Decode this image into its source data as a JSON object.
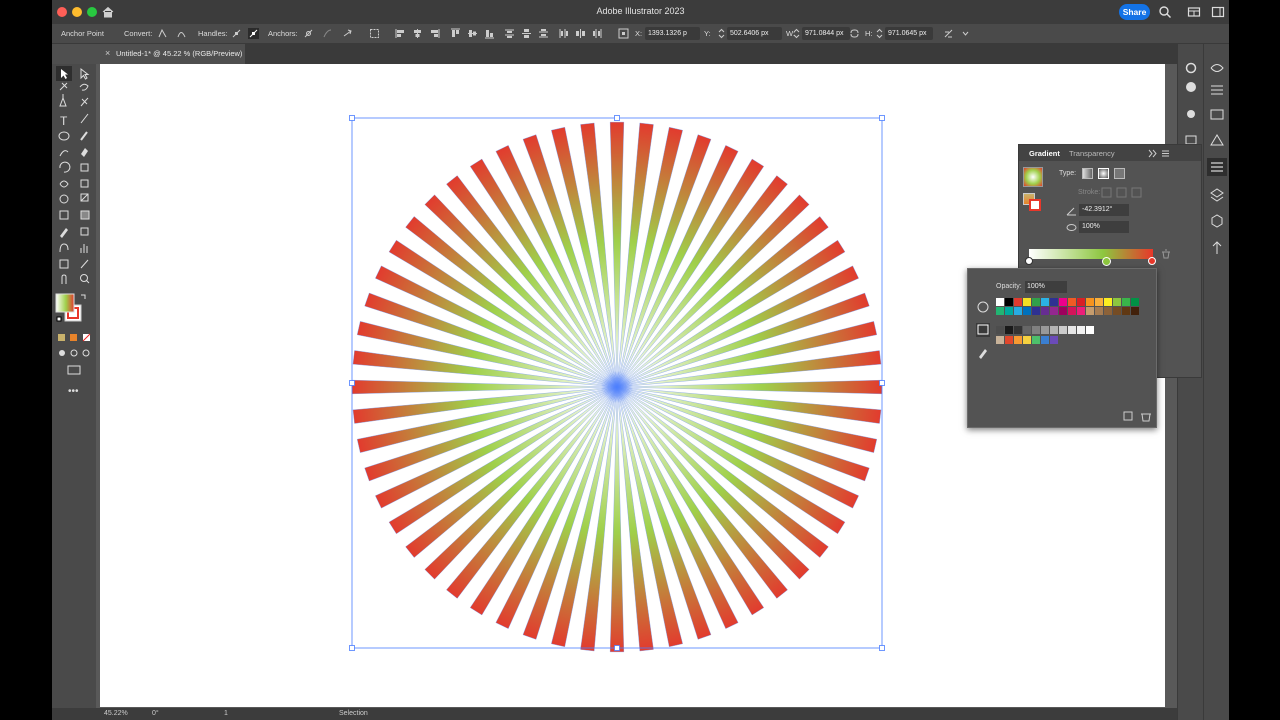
{
  "app": {
    "title": "Adobe Illustrator 2023",
    "share_label": "Share"
  },
  "control_bar": {
    "tool_name": "Anchor Point",
    "convert_label": "Convert:",
    "handles_label": "Handles:",
    "anchors_label": "Anchors:",
    "x_label": "X:",
    "x_value": "1393.1326 p",
    "y_label": "Y:",
    "y_value": "502.6406 px",
    "w_label": "W:",
    "w_value": "971.0844 px",
    "h_label": "H:",
    "h_value": "971.0645 px"
  },
  "document": {
    "tab_title": "Untitled-1* @ 45.22 % (RGB/Preview)",
    "close_glyph": "×"
  },
  "status_bar": {
    "zoom": "45.22%",
    "rotation": "0°",
    "artboard": "1",
    "tool": "Selection"
  },
  "gradient_panel": {
    "tabs": [
      {
        "label": "Gradient",
        "active": true
      },
      {
        "label": "Transparency",
        "active": false
      }
    ],
    "type_label": "Type:",
    "stroke_label": "Stroke:",
    "angle_value": "-42.3912°",
    "aspect_value": "100%",
    "stop_colors": [
      "#ffffff",
      "#8dc63f",
      "#e8372a"
    ]
  },
  "swatch_popup": {
    "opacity_label": "Opacity:",
    "opacity_value": "100%"
  },
  "artwork": {
    "ray_count": 56,
    "gradient_colors": [
      "#ffffff",
      "#9fd04a",
      "#e23b2e"
    ],
    "center_color": "#4a7dff"
  },
  "colors": {
    "accent": "#1473e6",
    "selection": "#4a7dff",
    "ui_dark": "#3c3c3c",
    "ui_panel": "#535353"
  }
}
